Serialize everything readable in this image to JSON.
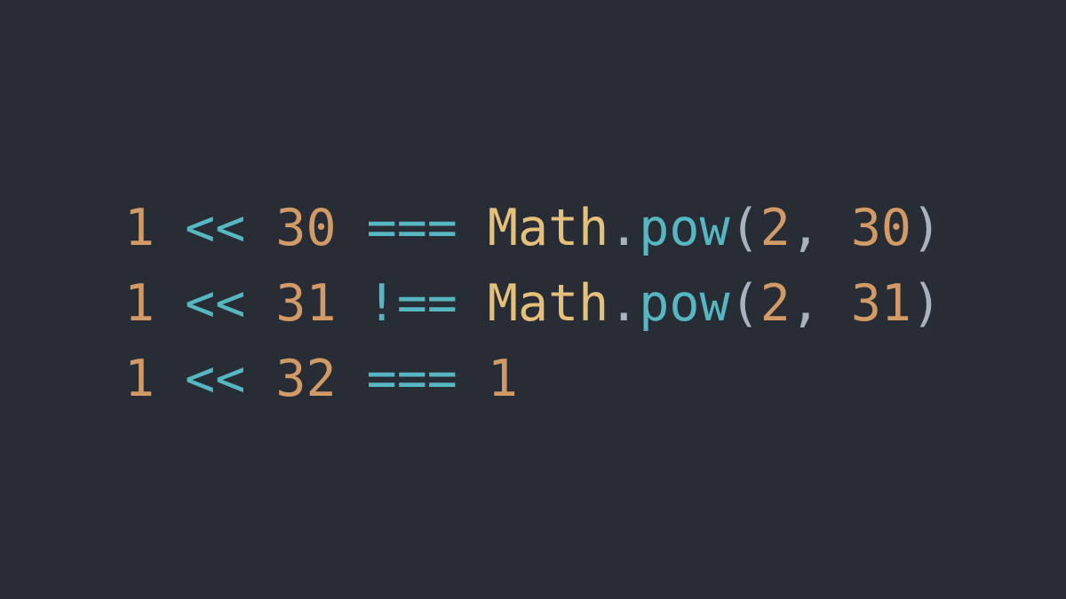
{
  "colors": {
    "background": "#282c34",
    "number": "#d19a66",
    "operator": "#56b6c2",
    "class": "#e5c07b",
    "function": "#56b6c2",
    "punctuation": "#abb2bf"
  },
  "code": {
    "lines": [
      {
        "tokens": [
          {
            "text": "1",
            "type": "number"
          },
          {
            "text": " ",
            "type": "space"
          },
          {
            "text": "<<",
            "type": "operator"
          },
          {
            "text": " ",
            "type": "space"
          },
          {
            "text": "30",
            "type": "number"
          },
          {
            "text": " ",
            "type": "space"
          },
          {
            "text": "===",
            "type": "operator"
          },
          {
            "text": " ",
            "type": "space"
          },
          {
            "text": "Math",
            "type": "class"
          },
          {
            "text": ".",
            "type": "punct"
          },
          {
            "text": "pow",
            "type": "function"
          },
          {
            "text": "(",
            "type": "punct"
          },
          {
            "text": "2",
            "type": "number"
          },
          {
            "text": ",",
            "type": "punct"
          },
          {
            "text": " ",
            "type": "space"
          },
          {
            "text": "30",
            "type": "number"
          },
          {
            "text": ")",
            "type": "punct"
          }
        ]
      },
      {
        "tokens": [
          {
            "text": "1",
            "type": "number"
          },
          {
            "text": " ",
            "type": "space"
          },
          {
            "text": "<<",
            "type": "operator"
          },
          {
            "text": " ",
            "type": "space"
          },
          {
            "text": "31",
            "type": "number"
          },
          {
            "text": " ",
            "type": "space"
          },
          {
            "text": "!==",
            "type": "operator"
          },
          {
            "text": " ",
            "type": "space"
          },
          {
            "text": "Math",
            "type": "class"
          },
          {
            "text": ".",
            "type": "punct"
          },
          {
            "text": "pow",
            "type": "function"
          },
          {
            "text": "(",
            "type": "punct"
          },
          {
            "text": "2",
            "type": "number"
          },
          {
            "text": ",",
            "type": "punct"
          },
          {
            "text": " ",
            "type": "space"
          },
          {
            "text": "31",
            "type": "number"
          },
          {
            "text": ")",
            "type": "punct"
          }
        ]
      },
      {
        "tokens": [
          {
            "text": "1",
            "type": "number"
          },
          {
            "text": " ",
            "type": "space"
          },
          {
            "text": "<<",
            "type": "operator"
          },
          {
            "text": " ",
            "type": "space"
          },
          {
            "text": "32",
            "type": "number"
          },
          {
            "text": " ",
            "type": "space"
          },
          {
            "text": "===",
            "type": "operator"
          },
          {
            "text": " ",
            "type": "space"
          },
          {
            "text": "1",
            "type": "number"
          }
        ]
      }
    ]
  }
}
